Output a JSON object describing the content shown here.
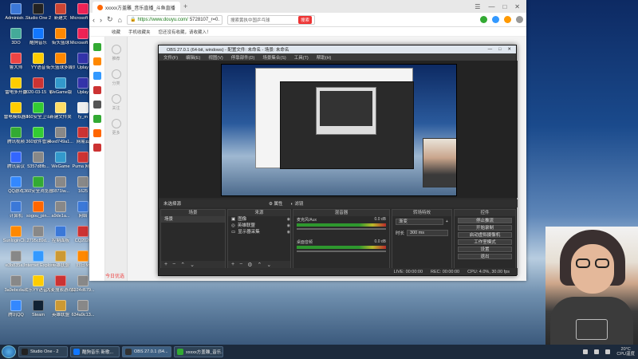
{
  "desktop_icons": [
    {
      "label": "Administr...",
      "color": "#3b78d8"
    },
    {
      "label": "Studio One 2",
      "color": "#222"
    },
    {
      "label": "新建文",
      "color": "#c43"
    },
    {
      "label": "Microsoft Offi",
      "color": "#e25"
    },
    {
      "label": "3DO",
      "color": "#4a9"
    },
    {
      "label": "酷狗音乐",
      "color": "#17f"
    },
    {
      "label": "街头篮球",
      "color": "#f80"
    },
    {
      "label": "Microsoft Offi",
      "color": "#e25"
    },
    {
      "label": "鲁大师",
      "color": "#e44"
    },
    {
      "label": "YY语音",
      "color": "#fc0"
    },
    {
      "label": "街头篮球多媒体播放工具",
      "color": "#f80"
    },
    {
      "label": "Uplay",
      "color": "#33a"
    },
    {
      "label": "雷电多开器",
      "color": "#fc0"
    },
    {
      "label": "2020-03-15 【福利】-6.",
      "color": "#c33"
    },
    {
      "label": "WeGame版",
      "color": "#39c"
    },
    {
      "label": "Uplay",
      "color": "#33a"
    },
    {
      "label": "雷电模拟器4",
      "color": "#fc0"
    },
    {
      "label": "360安全卫士",
      "color": "#3c3"
    },
    {
      "label": "新建文件夹",
      "color": "#fd6"
    },
    {
      "label": "fy_m",
      "color": "#eee"
    },
    {
      "label": "腾讯视频",
      "color": "#3a3"
    },
    {
      "label": "360软件管家",
      "color": "#3c3"
    },
    {
      "label": "4ked749a1...",
      "color": "#888"
    },
    {
      "label": "网易云",
      "color": "#c33"
    },
    {
      "label": "腾讯会议",
      "color": "#36f"
    },
    {
      "label": "5357d8fb...",
      "color": "#888"
    },
    {
      "label": "WeGame",
      "color": "#39c"
    },
    {
      "label": "Puma 网页",
      "color": "#c33"
    },
    {
      "label": "QQ游戏",
      "color": "#38f"
    },
    {
      "label": "360安全浏览器",
      "color": "#3a3"
    },
    {
      "label": "0871lw...",
      "color": "#888"
    },
    {
      "label": "1625",
      "color": "#888"
    },
    {
      "label": "计算机",
      "color": "#3b78d8"
    },
    {
      "label": "sogou_pin...",
      "color": "#f60"
    },
    {
      "label": "a9de1a...",
      "color": "#888"
    },
    {
      "label": "网络",
      "color": "#3b78d8"
    },
    {
      "label": "SunloginCli...",
      "color": "#f80"
    },
    {
      "label": "2795c89d...",
      "color": "#888"
    },
    {
      "label": "控制面板",
      "color": "#3b78d8"
    },
    {
      "label": "CQ2020",
      "color": "#c33"
    },
    {
      "label": "e3b835a...",
      "color": "#888"
    },
    {
      "label": "Internet Explorer",
      "color": "#39f"
    },
    {
      "label": "英雄联盟",
      "color": "#c93"
    },
    {
      "label": "向日葵",
      "color": "#f80"
    },
    {
      "label": "3a9ebcda...",
      "color": "#888"
    },
    {
      "label": "欢乐YY语音手机版",
      "color": "#fc0"
    },
    {
      "label": "大麦搜索游戏助手",
      "color": "#c33"
    },
    {
      "label": "6924d679...",
      "color": "#888"
    },
    {
      "label": "腾讯QQ",
      "color": "#38f"
    },
    {
      "label": "Steam",
      "color": "#123"
    },
    {
      "label": "英雄联盟",
      "color": "#c93"
    },
    {
      "label": "634a9c13...",
      "color": "#888"
    }
  ],
  "browser": {
    "tab_title": "xxxxx方盖雕_音乐直播_斗鱼直播",
    "new_tab": "+",
    "url_host": "https://www.douyu.com/",
    "url_rest": "5728107_r=0.",
    "search_placeholder": "搜索黄执中国乒乓球",
    "search_button": "搜索",
    "bookmarks": [
      "收藏",
      "手机收藏夹",
      "您还没有收藏，请收藏入！"
    ],
    "footer_text": "今日优选",
    "page_side": [
      "推荐",
      "分类",
      "关注",
      "更多"
    ]
  },
  "obs": {
    "title": "OBS 27.0.1 (64-bit, windows) - 配置文件: 未命名 - 场景: 未命名",
    "menu": [
      "文件(F)",
      "编辑(E)",
      "视图(V)",
      "停靠部件(D)",
      "场景集合(S)",
      "工具(T)",
      "帮助(H)"
    ],
    "source_label": "未选择源",
    "props_label": "属性",
    "filter_label": "滤镜",
    "panels": {
      "scenes": {
        "title": "场景",
        "items": [
          "场景"
        ]
      },
      "sources": {
        "title": "来源",
        "items": [
          "图像",
          "英雄联盟",
          "显示器采集"
        ]
      },
      "mixer": {
        "title": "混音器",
        "tracks": [
          {
            "name": "麦克风/Aux",
            "db": "0.0 dB"
          },
          {
            "name": "桌面音频",
            "db": "0.0 dB"
          }
        ]
      },
      "transitions": {
        "title": "转场特效",
        "type": "渐变",
        "duration_label": "时长",
        "duration": "300 ms"
      },
      "controls": {
        "title": "控件",
        "buttons": [
          "停止推流",
          "开始录制",
          "启动虚拟摄像机",
          "工作室模式",
          "设置",
          "退出"
        ]
      }
    },
    "status": {
      "live": "LIVE: 00:00:00",
      "rec": "REC: 00:00:00",
      "cpu": "CPU: 4.0%, 30.00 fps"
    }
  },
  "taskbar": {
    "items": [
      {
        "label": "Studio One - 2",
        "color": "#222"
      },
      {
        "label": "酷狗音乐 新歌...",
        "color": "#17f"
      },
      {
        "label": "OBS 27.0.1 (64...",
        "color": "#333"
      },
      {
        "label": "xxxxx方盖雕_音乐...",
        "color": "#3a3"
      }
    ],
    "weather": "20°C",
    "weather_sub": "CPU温度"
  }
}
